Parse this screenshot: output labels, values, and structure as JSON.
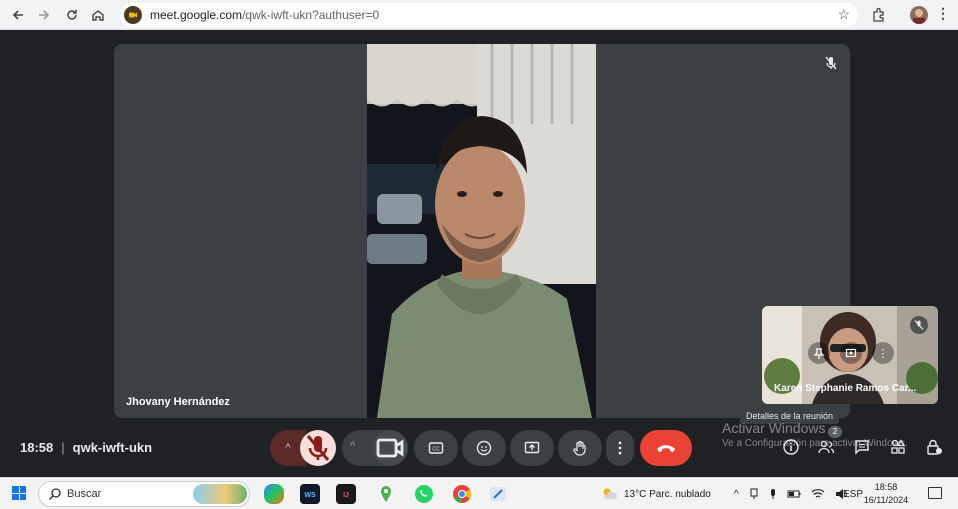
{
  "browser": {
    "url_host": "meet.google.com",
    "url_path": "/qwk-iwft-ukn?authuser=0"
  },
  "meeting": {
    "time": "18:58",
    "code": "qwk-iwft-ukn",
    "main_participant": "Jhovany Hernández",
    "self_participant": "Karen Stephanie Ramos Car...",
    "tooltip": "Detalles de la reunión",
    "participant_count": "2"
  },
  "watermark": {
    "title": "Activar Windows",
    "subtitle": "Ve a Configuración para activar Windows."
  },
  "taskbar": {
    "search_label": "Buscar",
    "weather": "13°C  Parc. nublado",
    "language": "ESP",
    "clock_time": "18:58",
    "clock_date": "16/11/2024"
  },
  "colors": {
    "meet_bg": "#202124",
    "tile_bg": "#3c4043",
    "hangup": "#ea4335",
    "mic_muted_bg": "#f9dedc",
    "mic_caret_bg": "#5c2b29"
  }
}
